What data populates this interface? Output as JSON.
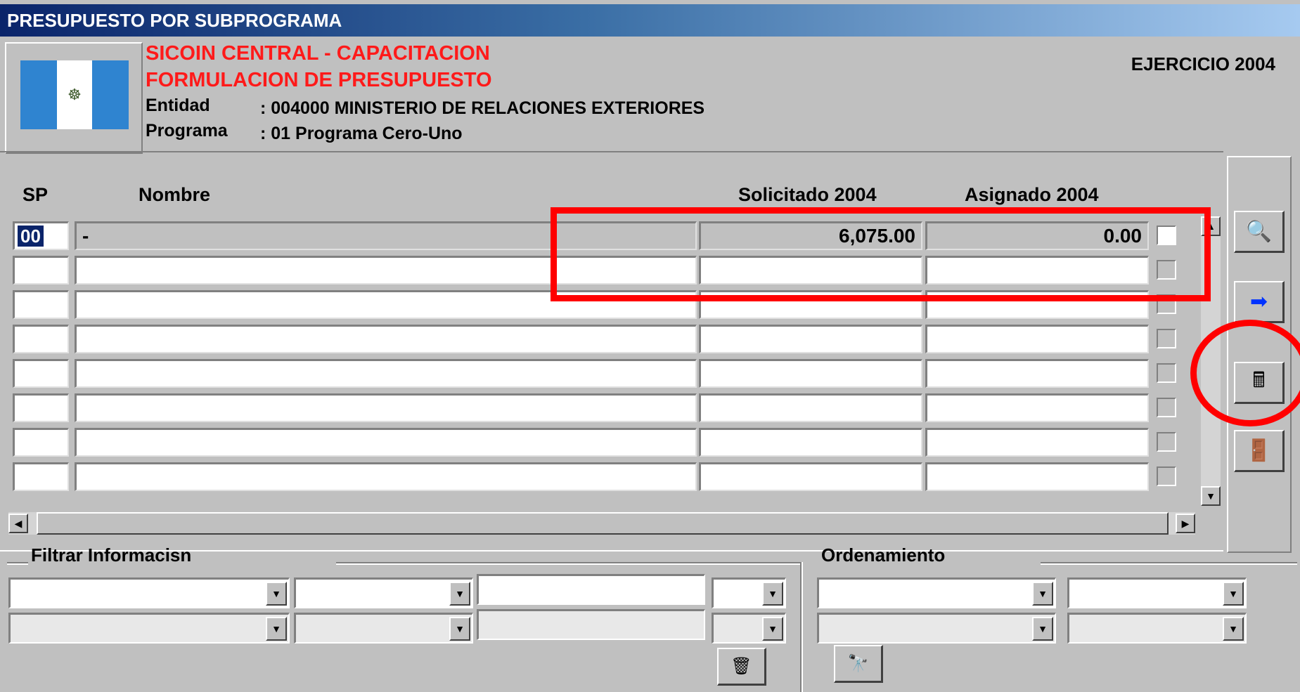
{
  "window": {
    "title": "PRESUPUESTO POR SUBPROGRAMA"
  },
  "header": {
    "system": "SICOIN CENTRAL - CAPACITACION",
    "module": "FORMULACION DE PRESUPUESTO",
    "entidad_label": "Entidad",
    "entidad_value": ":  004000  MINISTERIO DE RELACIONES   EXTERIORES",
    "programa_label": "Programa",
    "programa_value": ":  01  Programa Cero-Uno",
    "ejercicio": "EJERCICIO 2004",
    "flag_emblem": "☸"
  },
  "grid": {
    "columns": {
      "sp": "SP",
      "nombre": "Nombre",
      "solicitado": "Solicitado 2004",
      "asignado": "Asignado 2004"
    },
    "rows": [
      {
        "sp": "00",
        "nombre": "-",
        "solicitado": "6,075.00",
        "asignado": "0.00"
      },
      {
        "sp": "",
        "nombre": "",
        "solicitado": "",
        "asignado": ""
      },
      {
        "sp": "",
        "nombre": "",
        "solicitado": "",
        "asignado": ""
      },
      {
        "sp": "",
        "nombre": "",
        "solicitado": "",
        "asignado": ""
      },
      {
        "sp": "",
        "nombre": "",
        "solicitado": "",
        "asignado": ""
      },
      {
        "sp": "",
        "nombre": "",
        "solicitado": "",
        "asignado": ""
      },
      {
        "sp": "",
        "nombre": "",
        "solicitado": "",
        "asignado": ""
      },
      {
        "sp": "",
        "nombre": "",
        "solicitado": "",
        "asignado": ""
      }
    ]
  },
  "toolbar": {
    "buttons": [
      {
        "name": "search-detail-button",
        "icon": "search-document-icon",
        "glyph": "🔍"
      },
      {
        "name": "next-button",
        "icon": "arrow-right-icon",
        "glyph": "➡"
      },
      {
        "name": "calculator-button",
        "icon": "calculator-icon",
        "glyph": "🖩"
      },
      {
        "name": "exit-button",
        "icon": "exit-door-icon",
        "glyph": "🚪"
      }
    ]
  },
  "filter": {
    "label": "Filtrar Informacisn",
    "clear_button_glyph": "🗑"
  },
  "order": {
    "label": "Ordenamiento",
    "search_button_glyph": "🔭"
  },
  "scroll": {
    "left": "◀",
    "right": "▶",
    "up": "▲",
    "down": "▼",
    "drop": "▼"
  },
  "colors": {
    "accent_annotation": "#ff0000",
    "header_red": "#ff1a1a",
    "title_gradient_start": "#0a246a"
  }
}
